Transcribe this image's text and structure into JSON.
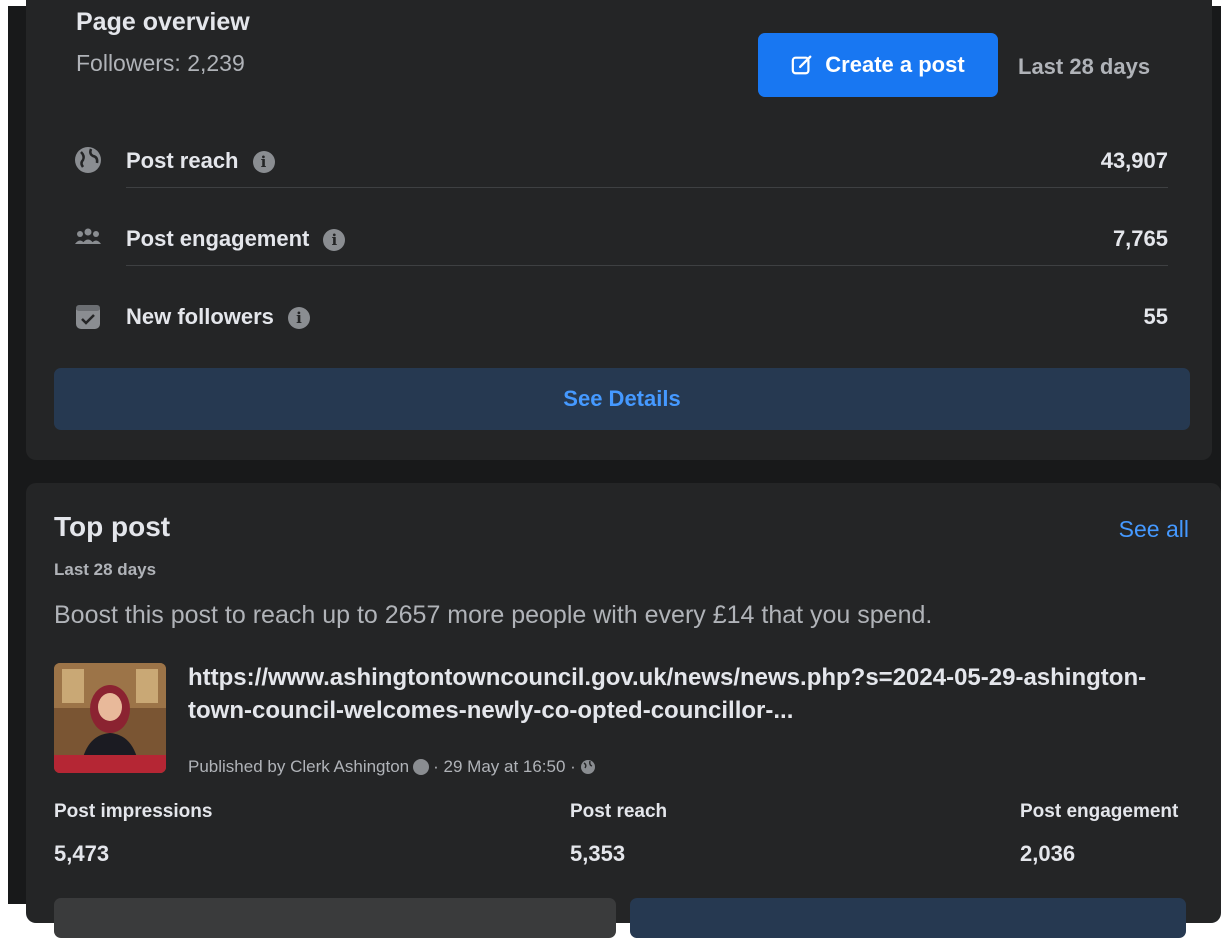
{
  "overview": {
    "title": "Page overview",
    "followers": "Followers: 2,239",
    "create_post": "Create a post",
    "range": "Last 28 days",
    "metrics": [
      {
        "label": "Post reach",
        "value": "43,907",
        "icon": "globe-icon"
      },
      {
        "label": "Post engagement",
        "value": "7,765",
        "icon": "people-icon"
      },
      {
        "label": "New followers",
        "value": "55",
        "icon": "calendar-check-icon"
      }
    ],
    "see_details": "See Details"
  },
  "top_post": {
    "title": "Top post",
    "range": "Last 28 days",
    "see_all": "See all",
    "boost_text": "Boost this post to reach up to 2657 more people with every £14 that you spend.",
    "link": "https://www.ashingtontowncouncil.gov.uk/news/news.php?s=2024-05-29-ashington-town-council-welcomes-newly-co-opted-councillor-...",
    "published_by": "Published by Clerk Ashington",
    "published_date": "· 29 May at 16:50 ·",
    "stats": [
      {
        "label": "Post impressions",
        "value": "5,473"
      },
      {
        "label": "Post reach",
        "value": "5,353"
      },
      {
        "label": "Post engagement",
        "value": "2,036"
      }
    ]
  },
  "colors": {
    "background": "#18191a",
    "card": "#242526",
    "primary": "#1877f2",
    "link": "#4599ff",
    "secondary_text": "#b0b3b8"
  }
}
